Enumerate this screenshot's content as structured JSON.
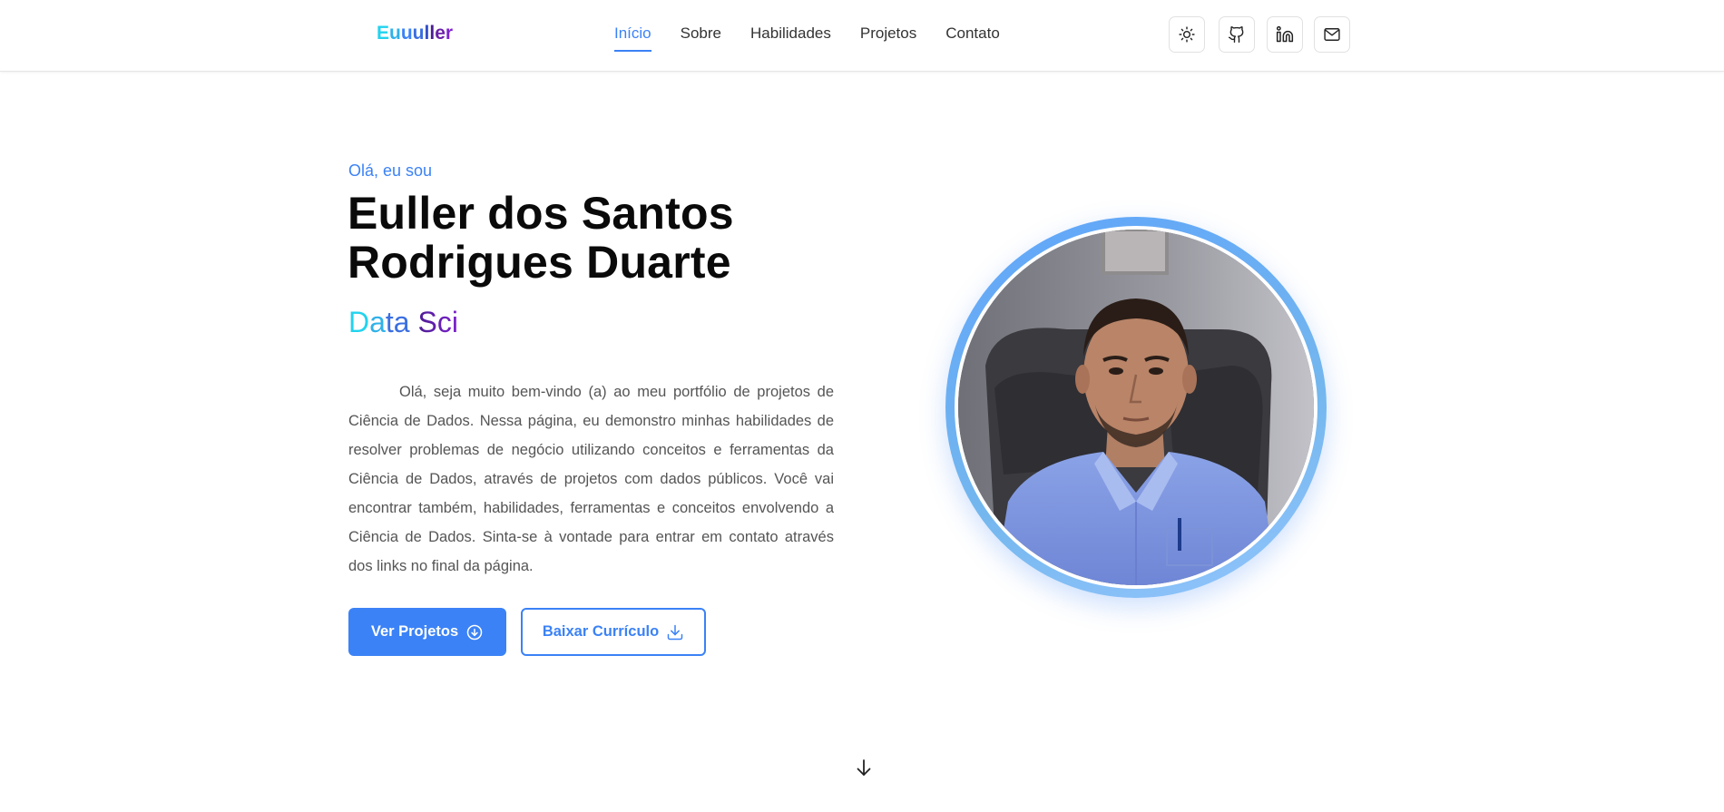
{
  "header": {
    "brand": [
      "E",
      "u",
      "u",
      "u",
      "l",
      "l",
      "e",
      "r"
    ],
    "brand_colors": [
      "#22d3ee",
      "#2fb1e9",
      "#3b82f6",
      "#3b6fe0",
      "#3450c8",
      "#4c1d95",
      "#6b21a8",
      "#7e22ce"
    ],
    "nav": [
      {
        "label": "Início",
        "active": true
      },
      {
        "label": "Sobre",
        "active": false
      },
      {
        "label": "Habilidades",
        "active": false
      },
      {
        "label": "Projetos",
        "active": false
      },
      {
        "label": "Contato",
        "active": false
      }
    ],
    "icons": [
      "sun-icon",
      "github-icon",
      "linkedin-icon",
      "mail-icon"
    ]
  },
  "hero": {
    "greeting": "Olá, eu sou",
    "name": "Euller dos Santos Rodrigues Duarte",
    "role_parts": [
      "D",
      "a",
      "ta ",
      "Sci"
    ],
    "intro": "Olá, seja muito bem-vindo (a) ao meu portfólio de projetos de Ciência de Dados. Nessa página, eu demonstro minhas habilidades de resolver problemas de negócio utilizando conceitos e ferramentas da Ciência de Dados, através de projetos com dados públicos. Você vai encontrar também, habilidades, ferramentas e conceitos envolvendo a Ciência de Dados. Sinta-se à vontade para entrar em contato através dos links no final da página.",
    "primary_button": "Ver Projetos",
    "secondary_button": "Baixar Currículo"
  },
  "colors": {
    "accent": "#3b82f6",
    "text_dark": "#0a0a0a",
    "text_muted": "#555555"
  }
}
